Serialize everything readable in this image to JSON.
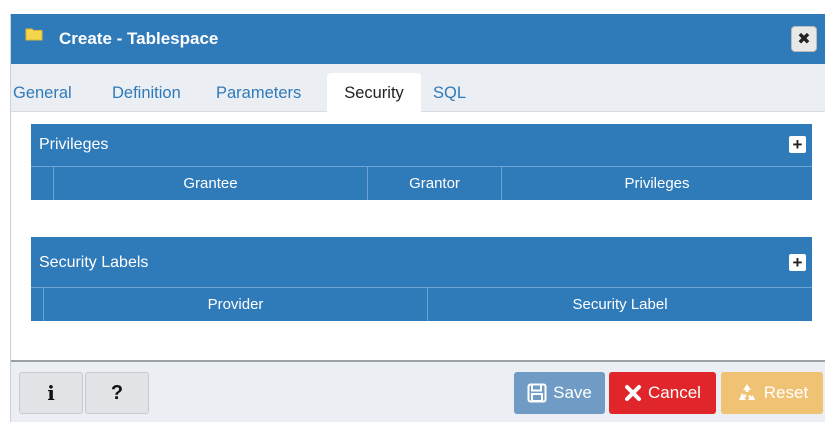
{
  "dialog": {
    "title": "Create - Tablespace",
    "close_glyph": "✖"
  },
  "tabs": [
    {
      "label": "General",
      "active": false
    },
    {
      "label": "Definition",
      "active": false
    },
    {
      "label": "Parameters",
      "active": false
    },
    {
      "label": "Security",
      "active": true
    },
    {
      "label": "SQL",
      "active": false
    }
  ],
  "privileges": {
    "title": "Privileges",
    "add_glyph": "+",
    "columns": [
      "Grantee",
      "Grantor",
      "Privileges"
    ],
    "rows": []
  },
  "security_labels": {
    "title": "Security Labels",
    "add_glyph": "+",
    "columns": [
      "Provider",
      "Security Label"
    ],
    "rows": []
  },
  "footer": {
    "info_glyph": "i",
    "help_glyph": "?",
    "save_label": "Save",
    "cancel_label": "Cancel",
    "reset_label": "Reset"
  },
  "colors": {
    "primary": "#2f7ab9",
    "save": "#6f9bc4",
    "cancel": "#e0262a",
    "reset": "#f0c274",
    "folder_icon": "#f3d54e"
  },
  "icons": [
    "folder-icon",
    "close-icon",
    "add-icon",
    "info-icon",
    "help-icon",
    "floppy-disk-icon",
    "x-icon",
    "recycle-icon"
  ]
}
